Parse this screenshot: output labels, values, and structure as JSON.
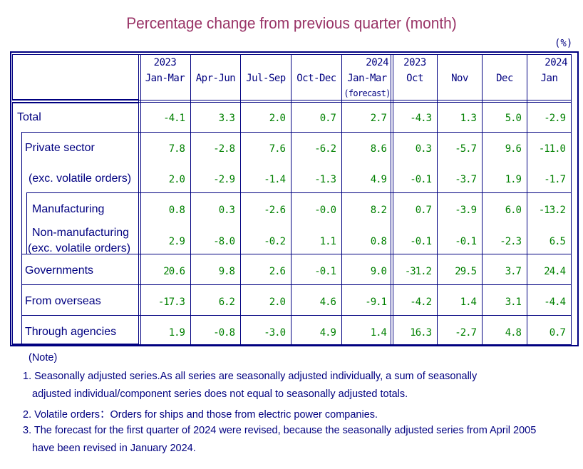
{
  "title": "Percentage change from previous quarter (month)",
  "unit": "(%)",
  "columns": [
    {
      "year": "2023",
      "period": "Jan-Mar",
      "sub": ""
    },
    {
      "year": "",
      "period": "Apr-Jun",
      "sub": ""
    },
    {
      "year": "",
      "period": "Jul-Sep",
      "sub": ""
    },
    {
      "year": "",
      "period": "Oct-Dec",
      "sub": ""
    },
    {
      "year": "2024",
      "period": "Jan-Mar",
      "sub": "(forecast)"
    },
    {
      "year": "2023",
      "period": "Oct",
      "sub": ""
    },
    {
      "year": "",
      "period": "Nov",
      "sub": ""
    },
    {
      "year": "",
      "period": "Dec",
      "sub": ""
    },
    {
      "year": "2024",
      "period": "Jan",
      "sub": ""
    }
  ],
  "rows": [
    {
      "label": "Total",
      "values": [
        "-4.1",
        "3.3",
        "2.0",
        "0.7",
        "2.7",
        "-4.3",
        "1.3",
        "5.0",
        "-2.9"
      ]
    },
    {
      "label": "Private sector",
      "values": [
        "7.8",
        "-2.8",
        "7.6",
        "-6.2",
        "8.6",
        "0.3",
        "-5.7",
        "9.6",
        "-11.0"
      ]
    },
    {
      "label": "(exc. volatile orders)",
      "values": [
        "2.0",
        "-2.9",
        "-1.4",
        "-1.3",
        "4.9",
        "-0.1",
        "-3.7",
        "1.9",
        "-1.7"
      ]
    },
    {
      "label": "Manufacturing",
      "values": [
        "0.8",
        "0.3",
        "-2.6",
        "-0.0",
        "8.2",
        "0.7",
        "-3.9",
        "6.0",
        "-13.2"
      ]
    },
    {
      "label": "Non-manufacturing",
      "label2": "(exc. volatile orders)",
      "values": [
        "2.9",
        "-8.0",
        "-0.2",
        "1.1",
        "0.8",
        "-0.1",
        "-0.1",
        "-2.3",
        "6.5"
      ]
    },
    {
      "label": "Governments",
      "values": [
        "20.6",
        "9.8",
        "2.6",
        "-0.1",
        "9.0",
        "-31.2",
        "29.5",
        "3.7",
        "24.4"
      ]
    },
    {
      "label": "From overseas",
      "values": [
        "-17.3",
        "6.2",
        "2.0",
        "4.6",
        "-9.1",
        "-4.2",
        "1.4",
        "3.1",
        "-4.4"
      ]
    },
    {
      "label": "Through agencies",
      "values": [
        "1.9",
        "-0.8",
        "-3.0",
        "4.9",
        "1.4",
        "16.3",
        "-2.7",
        "4.8",
        "0.7"
      ]
    }
  ],
  "notes": {
    "heading": "(Note)",
    "lines": [
      "1. Seasonally adjusted series.As all series are seasonally adjusted individually,  a sum of seasonally",
      "adjusted individual/component series does not equal to seasonally adjusted totals.",
      "2. Volatile orders：Orders for ships and those from electric power companies.",
      "3. The forecast for the first quarter of 2024 were revised, because the seasonally adjusted series from April 2005",
      "have been revised in January 2024."
    ]
  },
  "colors": {
    "title": "#993366",
    "border": "#000080",
    "label": "#000080",
    "value": "#008000"
  }
}
